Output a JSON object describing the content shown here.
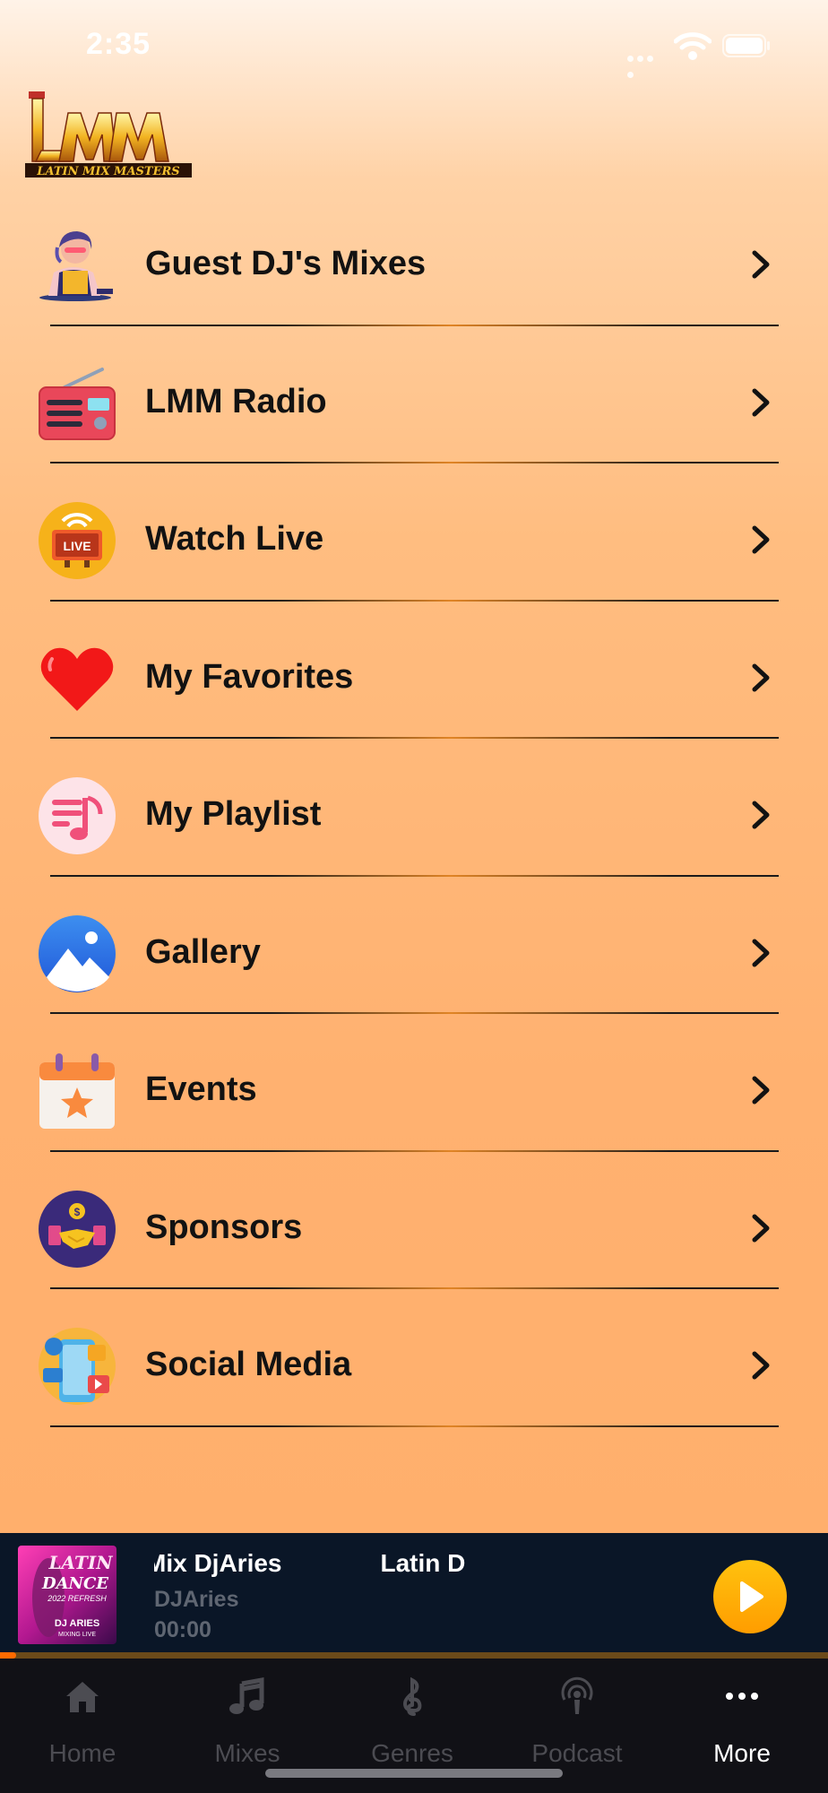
{
  "status_bar": {
    "time": "2:35"
  },
  "logo": {
    "alt": "LATIN MIX MASTERS"
  },
  "menu": [
    {
      "label": "Guest DJ's Mixes",
      "icon": "dj-icon"
    },
    {
      "label": "LMM Radio",
      "icon": "radio-icon"
    },
    {
      "label": "Watch Live",
      "icon": "live-tv-icon",
      "icon_text": "LIVE"
    },
    {
      "label": "My Favorites",
      "icon": "heart-icon"
    },
    {
      "label": "My Playlist",
      "icon": "playlist-icon"
    },
    {
      "label": "Gallery",
      "icon": "gallery-icon"
    },
    {
      "label": "Events",
      "icon": "calendar-icon"
    },
    {
      "label": "Sponsors",
      "icon": "handshake-icon"
    },
    {
      "label": "Social Media",
      "icon": "social-media-icon"
    }
  ],
  "mini_player": {
    "title_fragment_1": "Mix DjAries",
    "title_fragment_2": "Latin D",
    "artist": "DJAries",
    "time": "00:00",
    "progress_fraction": 0.02,
    "cover_text": {
      "line1": "LATIN",
      "line2": "DANCE",
      "line3": "2022 REFRESH",
      "line4": "DJ ARIES",
      "line5": "MIXING LIVE"
    }
  },
  "tabs": [
    {
      "label": "Home",
      "icon": "home-icon",
      "active": false
    },
    {
      "label": "Mixes",
      "icon": "music-note-icon",
      "active": false
    },
    {
      "label": "Genres",
      "icon": "treble-clef-icon",
      "active": false
    },
    {
      "label": "Podcast",
      "icon": "podcast-icon",
      "active": false
    },
    {
      "label": "More",
      "icon": "more-dots-icon",
      "active": true
    }
  ],
  "colors": {
    "accent": "#ff9d00",
    "player_bg": "#0a1627",
    "tab_bg": "#111116",
    "tab_inactive": "#4c4c52",
    "tab_active": "#ffffff"
  }
}
